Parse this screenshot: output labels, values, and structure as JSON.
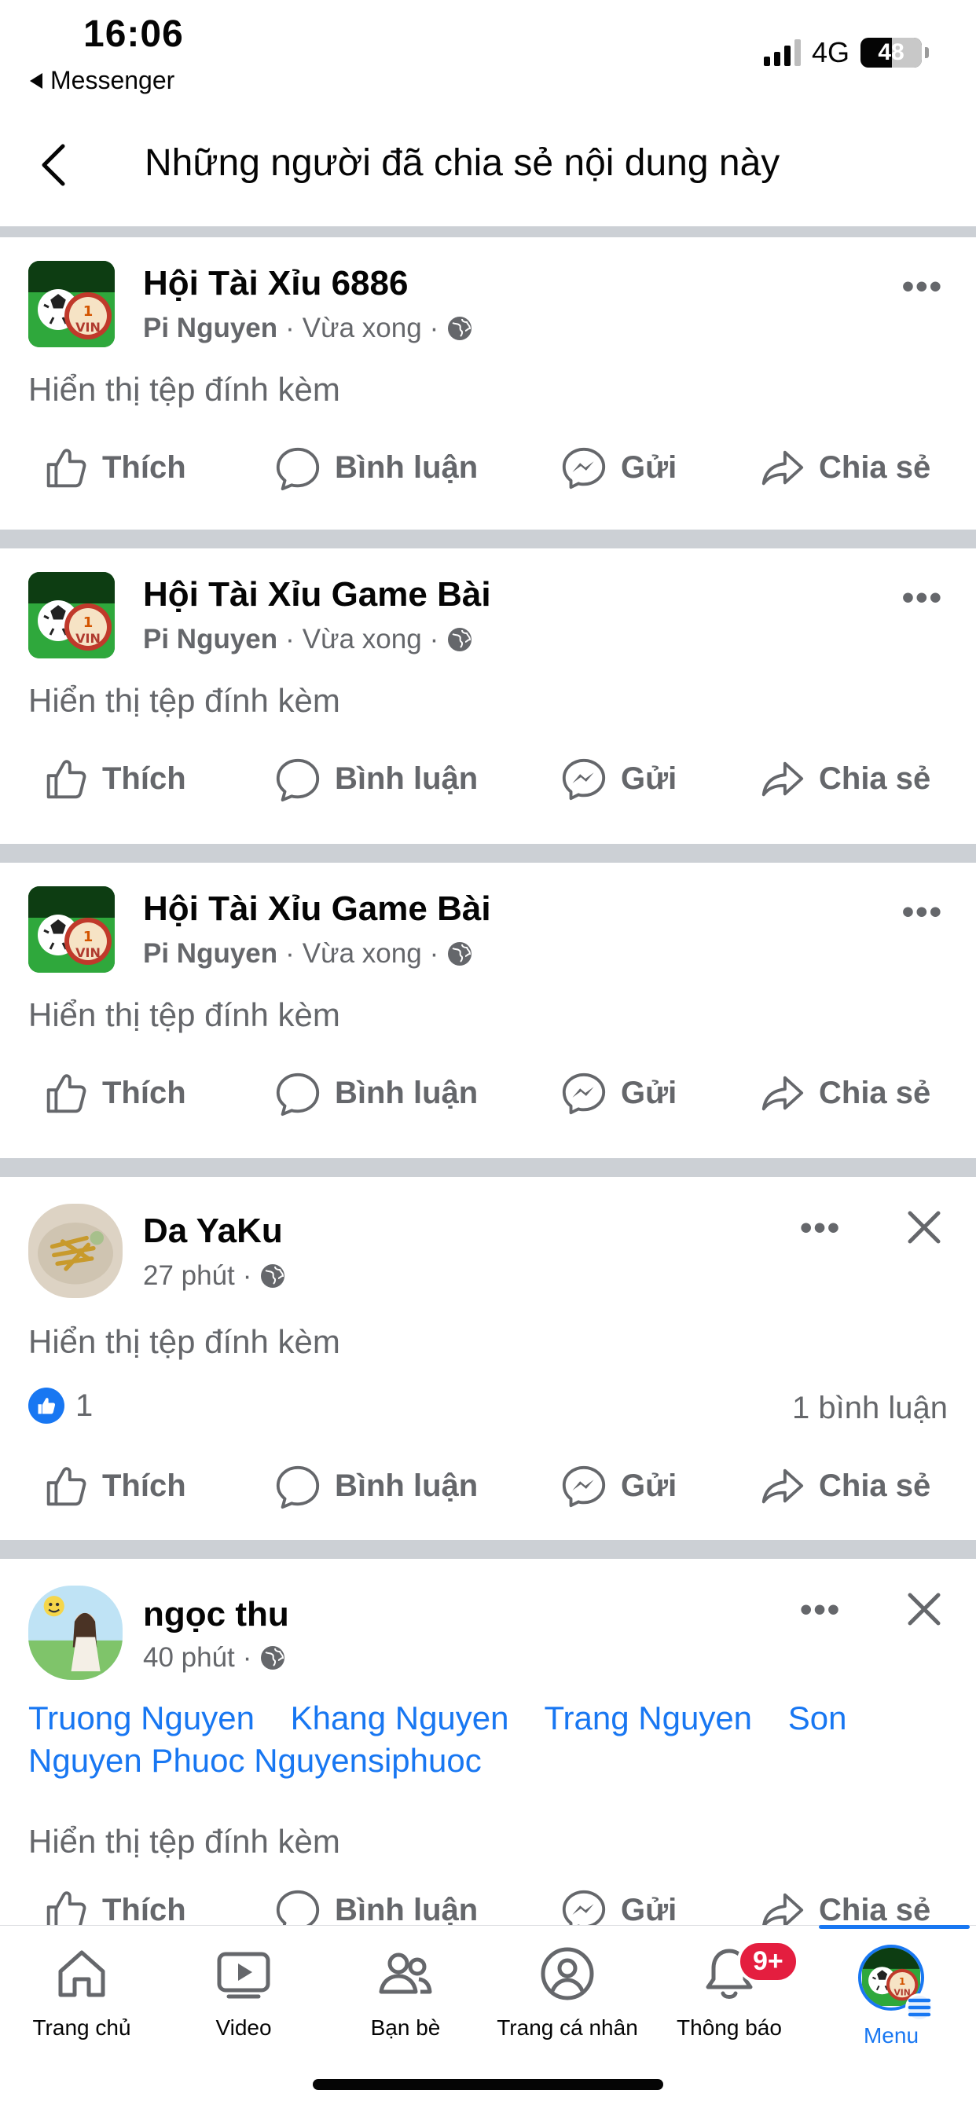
{
  "status_bar": {
    "time": "16:06",
    "back_app": "Messenger",
    "network": "4G",
    "battery": "48"
  },
  "header": {
    "title": "Những người đã chia sẻ nội dung này"
  },
  "actions": {
    "like": "Thích",
    "comment": "Bình luận",
    "send": "Gửi",
    "share": "Chia sẻ"
  },
  "posts": [
    {
      "title": "Hội Tài Xỉu 6886",
      "author": "Pi Nguyen",
      "time": "Vừa xong",
      "attachment": "Hiển thị tệp đính kèm"
    },
    {
      "title": "Hội Tài Xỉu Game Bài",
      "author": "Pi Nguyen",
      "time": "Vừa xong",
      "attachment": "Hiển thị tệp đính kèm"
    },
    {
      "title": "Hội Tài Xỉu Game Bài",
      "author": "Pi Nguyen",
      "time": "Vừa xong",
      "attachment": "Hiển thị tệp đính kèm"
    },
    {
      "title": "Da YaKu",
      "time": "27 phút",
      "attachment": "Hiển thị tệp đính kèm",
      "like_count": "1",
      "comment_count": "1 bình luận"
    },
    {
      "title": "ngọc thu",
      "time": "40 phút",
      "tags": [
        "Truong Nguyen",
        "Khang Nguyen",
        "Trang Nguyen",
        "Son",
        "Nguyen Phuoc Nguyensiphuoc"
      ],
      "attachment": "Hiển thị tệp đính kèm"
    }
  ],
  "bottom_nav": {
    "items": [
      {
        "label": "Trang chủ",
        "icon": "home-icon"
      },
      {
        "label": "Video",
        "icon": "video-icon"
      },
      {
        "label": "Bạn bè",
        "icon": "friends-icon"
      },
      {
        "label": "Trang cá nhân",
        "icon": "profile-icon"
      },
      {
        "label": "Thông báo",
        "icon": "bell-icon",
        "badge": "9+"
      },
      {
        "label": "Menu",
        "icon": "menu-avatar",
        "active": true
      }
    ]
  },
  "colors": {
    "accent": "#1877f2",
    "secondary_text": "#65676b",
    "divider": "#ccd0d5",
    "badge": "#e41e3f"
  }
}
